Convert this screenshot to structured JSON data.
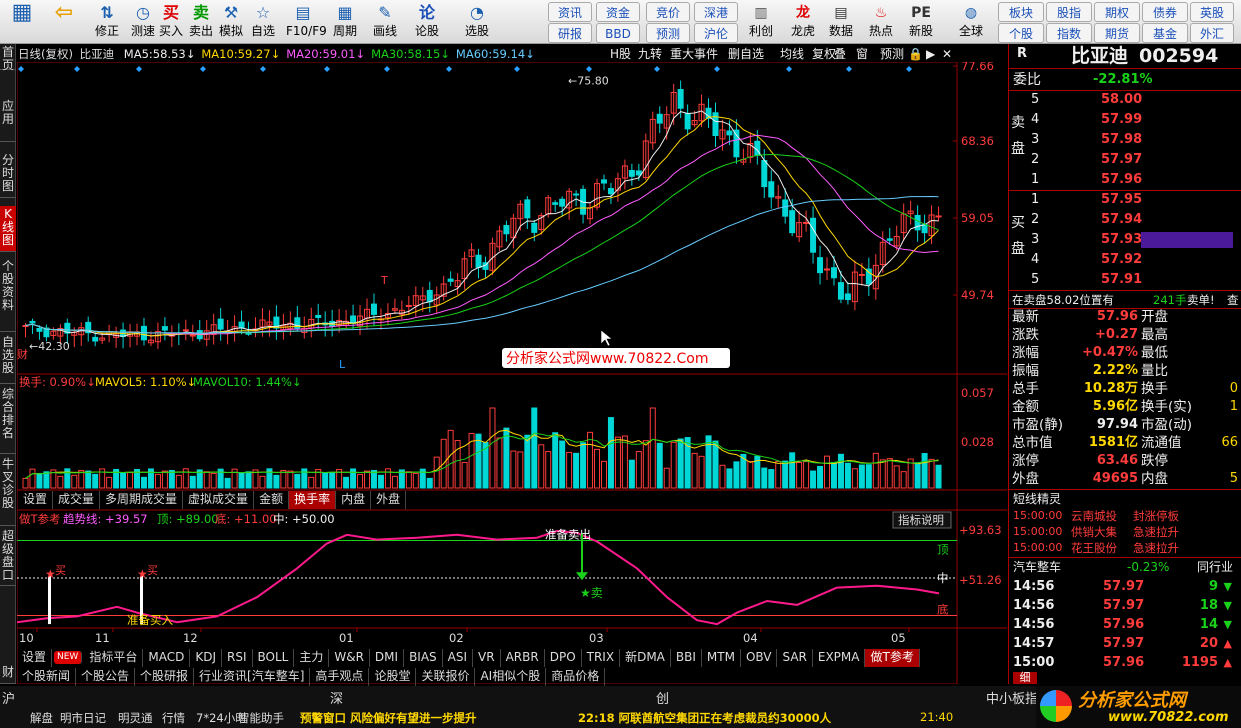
{
  "toolbar": {
    "items": [
      {
        "label": "",
        "icon": "grid-icon"
      },
      {
        "label": "",
        "icon": "back-arrow-icon"
      },
      {
        "label": "修正",
        "icon": "arrow-updown-icon"
      },
      {
        "label": "测速",
        "icon": "clock-icon"
      },
      {
        "label": "买入",
        "glyph": "买"
      },
      {
        "label": "卖出",
        "glyph": "卖"
      },
      {
        "label": "模拟",
        "icon": "hammer-icon"
      },
      {
        "label": "自选",
        "icon": "star-icon"
      },
      {
        "label": "F10/F9",
        "icon": "f10-icon"
      },
      {
        "label": "周期",
        "icon": "calendar-icon"
      },
      {
        "label": "画线",
        "icon": "pen-icon"
      },
      {
        "label": "论股",
        "glyph": "论"
      },
      {
        "label": "选股",
        "icon": "chart-circle-icon"
      },
      {
        "label": "",
        "glyph": ""
      }
    ],
    "small": [
      "资讯",
      "资金",
      "竞价",
      "深港",
      "研报",
      "BBD",
      "预测",
      "沪伦"
    ],
    "more": [
      "利创",
      "龙虎",
      "数据",
      "热点",
      "新股",
      "全球"
    ],
    "right_small": [
      "板块",
      "股指",
      "期权",
      "债券",
      "英股",
      "个股",
      "指数",
      "期货",
      "基金",
      "外汇"
    ]
  },
  "left_tabs": [
    "首页",
    "应用",
    "分时图",
    "K线图",
    "个股资料",
    "自选股",
    "综合排名",
    "牛叉诊股",
    "超级盘口",
    "财"
  ],
  "chart": {
    "title": "日线(复权)",
    "stock": "比亚迪",
    "ma": [
      {
        "k": "MA5:",
        "v": "58.53↓",
        "c": "#eee"
      },
      {
        "k": "MA10:",
        "v": "59.27↓",
        "c": "#ffd800"
      },
      {
        "k": "MA20:",
        "v": "59.01↓",
        "c": "#ff5cff"
      },
      {
        "k": "MA30:",
        "v": "58.15↓",
        "c": "#19d219"
      },
      {
        "k": "MA60:",
        "v": "59.14↓",
        "c": "#66ccff"
      }
    ],
    "buttons": [
      "H股",
      "九转",
      "重大事件",
      "删自选",
      "均线",
      "复权",
      "叠",
      "窗",
      "预测"
    ],
    "yaxis": [
      "77.66",
      "68.36",
      "59.05",
      "49.74"
    ],
    "hi_label": "75.80",
    "lo_label": "42.30",
    "t_mark": "T",
    "l_mark": "L",
    "watermark": "分析家公式网www.70822.Com",
    "vol_info": {
      "a": "换手: 0.90%↓",
      "b": "MAVOL5: 1.10%↓",
      "c": "MAVOL10: 1.44%↓"
    },
    "vol_axis": [
      "0.057",
      "0.028"
    ],
    "vol_tabs": [
      "设置",
      "成交量",
      "多周期成交量",
      "虚拟成交量",
      "金额",
      "换手率",
      "内盘",
      "外盘"
    ],
    "ind_info": {
      "name": "做T参考",
      "trend": "趋势线: +39.57",
      "up": "顶: +89.00",
      "down": "底: +11.00",
      "mid": "中: +50.00"
    },
    "ind_btn": "指标说明",
    "ind_axis": [
      "+93.63",
      "+51.26"
    ],
    "ind_marks": {
      "top": "顶",
      "mid": "中",
      "bottom": "底",
      "buy": "买",
      "buy2": "买",
      "prep_buy": "准备买入",
      "prep_sell": "准备卖出",
      "sell": "★卖"
    },
    "months": [
      "10",
      "11",
      "12",
      "01",
      "02",
      "03",
      "04",
      "05"
    ],
    "ind_tabs": [
      "设置",
      "NEW",
      "指标平台",
      "MACD",
      "KDJ",
      "RSI",
      "BOLL",
      "主力",
      "W&R",
      "DMI",
      "BIAS",
      "ASI",
      "VR",
      "ARBR",
      "DPO",
      "TRIX",
      "新DMA",
      "BBI",
      "MTM",
      "OBV",
      "SAR",
      "EXPMA",
      "做T参考"
    ],
    "bottom_tabs": [
      "个股新闻",
      "个股公告",
      "个股研报",
      "行业资讯[汽车整车]",
      "高手观点",
      "论股堂",
      "关联报价",
      "AI相似个股",
      "商品价格"
    ]
  },
  "quote": {
    "market": "R",
    "name": "比亚迪",
    "code": "002594",
    "wb_label": "委比",
    "wb": "-22.81%",
    "sell_label": "卖盘",
    "buy_label": "买盘",
    "sell": [
      {
        "n": "5",
        "p": "58.00"
      },
      {
        "n": "4",
        "p": "57.99"
      },
      {
        "n": "3",
        "p": "57.98"
      },
      {
        "n": "2",
        "p": "57.97"
      },
      {
        "n": "1",
        "p": "57.96"
      }
    ],
    "buy": [
      {
        "n": "1",
        "p": "57.95"
      },
      {
        "n": "2",
        "p": "57.94"
      },
      {
        "n": "3",
        "p": "57.93"
      },
      {
        "n": "4",
        "p": "57.92"
      },
      {
        "n": "5",
        "p": "57.91"
      }
    ],
    "notice": "在卖盘58.02位置有",
    "notice_qty": "241手",
    "notice_end": "卖单!",
    "notice_btn": "查",
    "stats": [
      {
        "k": "最新",
        "v": "57.96",
        "c": "red",
        "k2": "开盘",
        "v2": ""
      },
      {
        "k": "涨跌",
        "v": "+0.27",
        "c": "red",
        "k2": "最高",
        "v2": ""
      },
      {
        "k": "涨幅",
        "v": "+0.47%",
        "c": "red",
        "k2": "最低",
        "v2": ""
      },
      {
        "k": "振幅",
        "v": "2.22%",
        "c": "yel",
        "k2": "量比",
        "v2": ""
      },
      {
        "k": "总手",
        "v": "10.28万",
        "c": "yel",
        "k2": "换手",
        "v2": "0"
      },
      {
        "k": "金额",
        "v": "5.96亿",
        "c": "yel",
        "k2": "换手(实)",
        "v2": "1"
      },
      {
        "k": "市盈(静)",
        "v": "97.94",
        "c": "wht",
        "k2": "市盈(动)",
        "v2": ""
      },
      {
        "k": "总市值",
        "v": "1581亿",
        "c": "yel",
        "k2": "流通值",
        "v2": "66"
      },
      {
        "k": "涨停",
        "v": "63.46",
        "c": "red",
        "k2": "跌停",
        "v2": ""
      },
      {
        "k": "外盘",
        "v": "49695",
        "c": "red",
        "k2": "内盘",
        "v2": "5"
      }
    ],
    "sprite_title": "短线精灵",
    "sprite": [
      {
        "t": "15:00:00",
        "n": "云南城投",
        "e": "封涨停板"
      },
      {
        "t": "15:00:00",
        "n": "供销大集",
        "e": "急速拉升"
      },
      {
        "t": "15:00:00",
        "n": "花王股份",
        "e": "急速拉升"
      }
    ],
    "industry": "汽车整车",
    "industry_chg": "-0.23%",
    "industry_btn": "同行业",
    "ticks": [
      {
        "t": "14:56",
        "p": "57.97",
        "q": "9",
        "d": "down"
      },
      {
        "t": "14:56",
        "p": "57.97",
        "q": "18",
        "d": "down"
      },
      {
        "t": "14:56",
        "p": "57.96",
        "q": "14",
        "d": "down"
      },
      {
        "t": "14:57",
        "p": "57.97",
        "q": "20",
        "d": "up"
      },
      {
        "t": "15:00",
        "p": "57.96",
        "q": "1195",
        "d": "up"
      }
    ],
    "detail_tab": "细"
  },
  "status": {
    "indices": [
      "沪",
      "深",
      "创",
      "中小板指"
    ],
    "bottom": [
      "解盘",
      "明市日记",
      "明灵通",
      "行情",
      "7*24小时",
      "智能助手"
    ],
    "news": "预警窗口 风险偏好有望进一步提升",
    "news2": "22:18 阿联酋航空集团正在考虑裁员约30000人",
    "clock": "21:40"
  },
  "logo": {
    "name": "分析家公式网",
    "url": "www.70822.com"
  }
}
